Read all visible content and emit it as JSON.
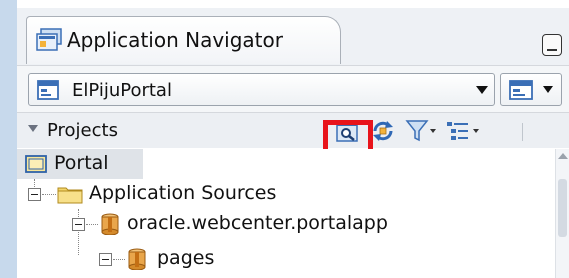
{
  "navigator": {
    "title": "Application Navigator",
    "title_icon": "application-navigator-icon",
    "minimize_icon": "minimize-icon"
  },
  "app_selector": {
    "selected": "ElPijuPortal",
    "icon": "application-icon",
    "menu_icon": "application-menu-icon"
  },
  "projects_panel": {
    "label": "Projects",
    "toolbar": [
      {
        "name": "search-icon",
        "highlighted": true
      },
      {
        "name": "refresh-icon"
      },
      {
        "name": "filter-icon"
      },
      {
        "name": "options-icon"
      }
    ],
    "highlight_color": "#e8141b"
  },
  "tree": {
    "items": [
      {
        "label": "Portal",
        "icon": "project-icon",
        "selected": true
      },
      {
        "label": "Application Sources",
        "icon": "folder-icon"
      },
      {
        "label": "oracle.webcenter.portalapp",
        "icon": "package-icon"
      },
      {
        "label": "pages",
        "icon": "package-icon"
      }
    ]
  }
}
